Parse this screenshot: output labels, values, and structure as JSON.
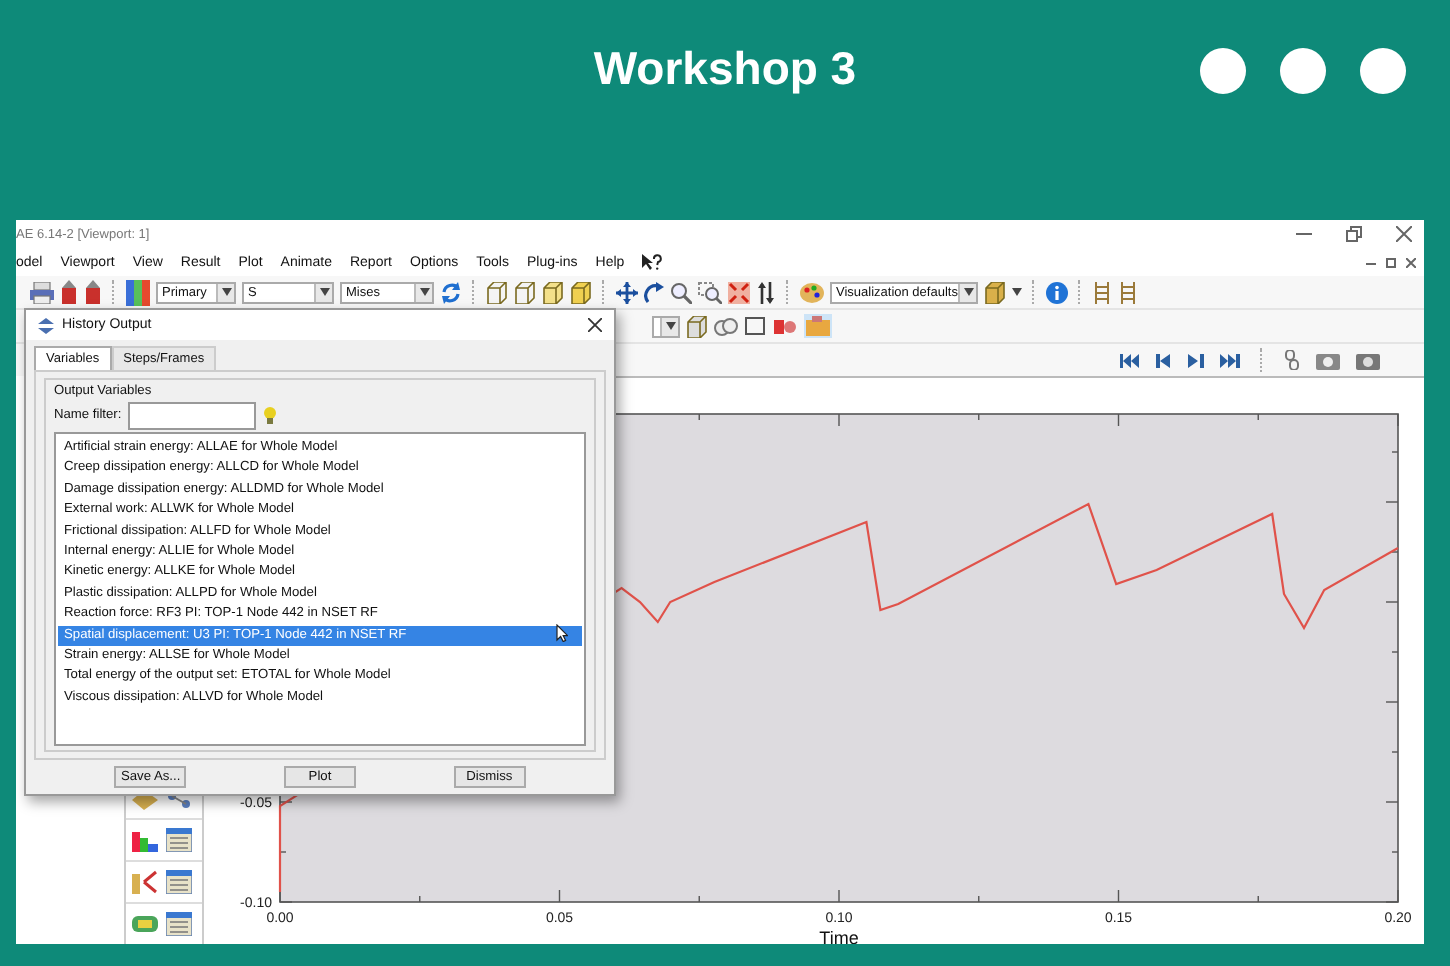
{
  "header": {
    "title": "Workshop 3"
  },
  "window": {
    "title": "AE 6.14-2 [Viewport: 1]"
  },
  "menu": [
    "odel",
    "Viewport",
    "View",
    "Result",
    "Plot",
    "Animate",
    "Report",
    "Options",
    "Tools",
    "Plug-ins",
    "Help"
  ],
  "toolbar": {
    "primary_combo": "Primary",
    "variable_combo": "S",
    "invariant_combo": "Mises",
    "style_combo": "Visualization defaults"
  },
  "dialog": {
    "title": "History Output",
    "tabs": [
      {
        "label": "Variables",
        "selected": true
      },
      {
        "label": "Steps/Frames",
        "selected": false
      }
    ],
    "group_title": "Output Variables",
    "filter_label": "Name filter:",
    "items": [
      {
        "label": "Artificial strain energy: ALLAE for Whole Model",
        "selected": false
      },
      {
        "label": "Creep dissipation energy: ALLCD for Whole Model",
        "selected": false
      },
      {
        "label": "Damage dissipation energy: ALLDMD for Whole Model",
        "selected": false
      },
      {
        "label": "External work: ALLWK for Whole Model",
        "selected": false
      },
      {
        "label": "Frictional dissipation: ALLFD for Whole Model",
        "selected": false
      },
      {
        "label": "Internal energy: ALLIE for Whole Model",
        "selected": false
      },
      {
        "label": "Kinetic energy: ALLKE for Whole Model",
        "selected": false
      },
      {
        "label": "Plastic dissipation: ALLPD for Whole Model",
        "selected": false
      },
      {
        "label": "Reaction force: RF3 PI: TOP-1 Node 442 in NSET RF",
        "selected": false
      },
      {
        "label": "Spatial displacement: U3 PI: TOP-1 Node 442 in NSET RF",
        "selected": true
      },
      {
        "label": "Strain energy: ALLSE for Whole Model",
        "selected": false
      },
      {
        "label": "Total energy of the output set: ETOTAL for Whole Model",
        "selected": false
      },
      {
        "label": "Viscous dissipation: ALLVD for Whole Model",
        "selected": false
      }
    ],
    "buttons": [
      "Save As...",
      "Plot",
      "Dismiss"
    ]
  },
  "plot": {
    "chart_data": {
      "type": "line",
      "xlabel": "Time",
      "xlim": [
        0,
        0.2
      ],
      "ylim": [
        -0.1,
        0.144
      ],
      "xticks": [
        {
          "value": 0,
          "label": "0.00"
        },
        {
          "value": 0.05,
          "label": "0.05"
        },
        {
          "value": 0.1,
          "label": "0.10"
        },
        {
          "value": 0.15,
          "label": "0.15"
        },
        {
          "value": 0.2,
          "label": "0.20"
        }
      ],
      "yticks": [
        {
          "value": -0.1,
          "label": "-0.10"
        },
        {
          "value": -0.05,
          "label": "-0.05"
        }
      ],
      "x": [
        0,
        0,
        0.0611,
        0.0644,
        0.0676,
        0.0698,
        0.0777,
        0.1049,
        0.1074,
        0.1106,
        0.1446,
        0.1496,
        0.1568,
        0.1775,
        0.1796,
        0.1832,
        0.1868,
        0.2
      ],
      "series": [
        {
          "color": "#e0524a",
          "values": [
            -0.095,
            -0.052,
            0.057,
            0.05,
            0.04,
            0.05,
            0.06,
            0.09,
            0.046,
            0.049,
            0.099,
            0.059,
            0.066,
            0.094,
            0.054,
            0.037,
            0.056,
            0.077
          ]
        }
      ]
    }
  }
}
